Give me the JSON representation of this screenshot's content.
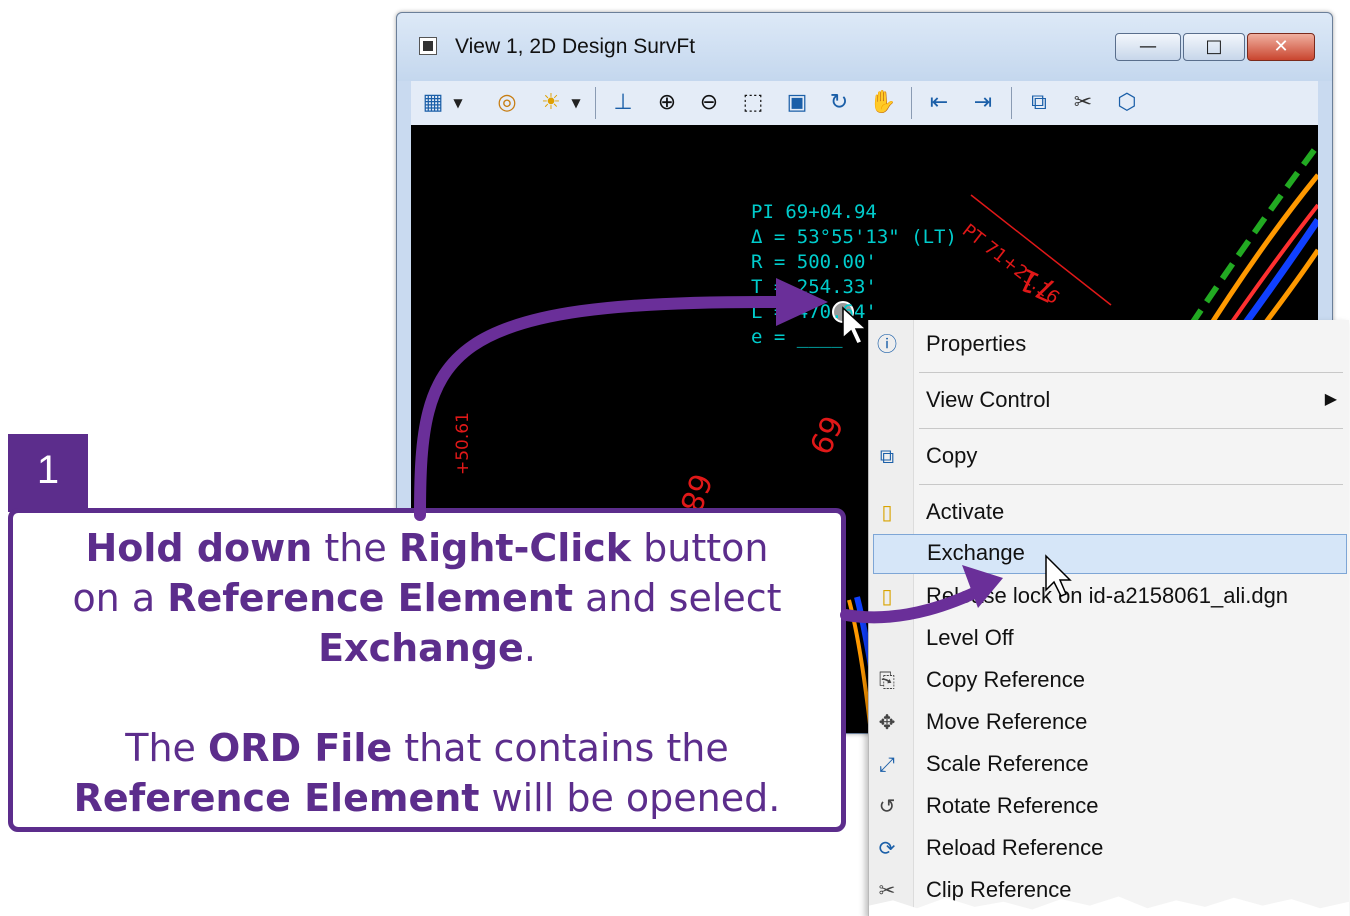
{
  "window": {
    "title": "View 1, 2D Design SurvFt",
    "buttons": {
      "minimize": "—",
      "maximize": "□",
      "close": "✕"
    }
  },
  "toolbar": {
    "icons": [
      "view-attributes-icon",
      "levels-icon",
      "display-style-icon",
      "update-view-icon",
      "zoom-in-icon",
      "zoom-out-icon",
      "window-area-icon",
      "fit-view-icon",
      "rotate-view-icon",
      "pan-view-icon",
      "previous-view-icon",
      "next-view-icon",
      "copy-view-icon",
      "clip-volume-icon",
      "clip-mask-icon"
    ]
  },
  "canvas": {
    "annotation_lines": [
      "PI 69+04.94",
      "Δ = 53°55'13\" (LT)",
      "R = 500.00'",
      "T = 254.33'",
      "L = 470.64'",
      "e = ____"
    ],
    "station_labels": [
      "PT 71+21.16",
      "71",
      "69",
      "68",
      "+50.61"
    ]
  },
  "context_menu": {
    "items": [
      {
        "label": "Properties",
        "icon": "properties-icon"
      },
      {
        "label": "View Control",
        "icon": "",
        "submenu": "▶"
      },
      {
        "label": "Copy",
        "icon": "copy-icon"
      },
      {
        "label": "Activate",
        "icon": "activate-icon"
      },
      {
        "label": "Exchange",
        "icon": "",
        "highlighted": true
      },
      {
        "label": "Release lock on id-a2158061_ali.dgn",
        "icon": "release-lock-icon"
      },
      {
        "label": "Level Off",
        "icon": ""
      },
      {
        "label": "Copy Reference",
        "icon": "copy-reference-icon"
      },
      {
        "label": "Move Reference",
        "icon": "move-reference-icon"
      },
      {
        "label": "Scale Reference",
        "icon": "scale-reference-icon"
      },
      {
        "label": "Rotate Reference",
        "icon": "rotate-reference-icon"
      },
      {
        "label": "Reload Reference",
        "icon": "reload-reference-icon"
      },
      {
        "label": "Clip Reference",
        "icon": "clip-reference-icon"
      }
    ]
  },
  "callout": {
    "step_number": "1",
    "line1_bold_a": "Hold down",
    "line1_text_a": " the ",
    "line1_bold_b": "Right-Click",
    "line1_text_b": " button",
    "line2_text_a": "on a ",
    "line2_bold_a": "Reference Element",
    "line2_text_b": " and select",
    "line3_bold": "Exchange",
    "line3_text": ".",
    "note_text_a": "The ",
    "note_bold_a": "ORD File",
    "note_text_b": " that contains the",
    "note_bold_b": "Reference Element",
    "note_text_c": " will be opened."
  },
  "colors": {
    "callout_purple": "#5c2d8c",
    "arrow_purple": "#6a2f99",
    "cad_cyan": "#00cccc",
    "cad_red": "#e01818",
    "menu_highlight": "#d6e6f8"
  }
}
